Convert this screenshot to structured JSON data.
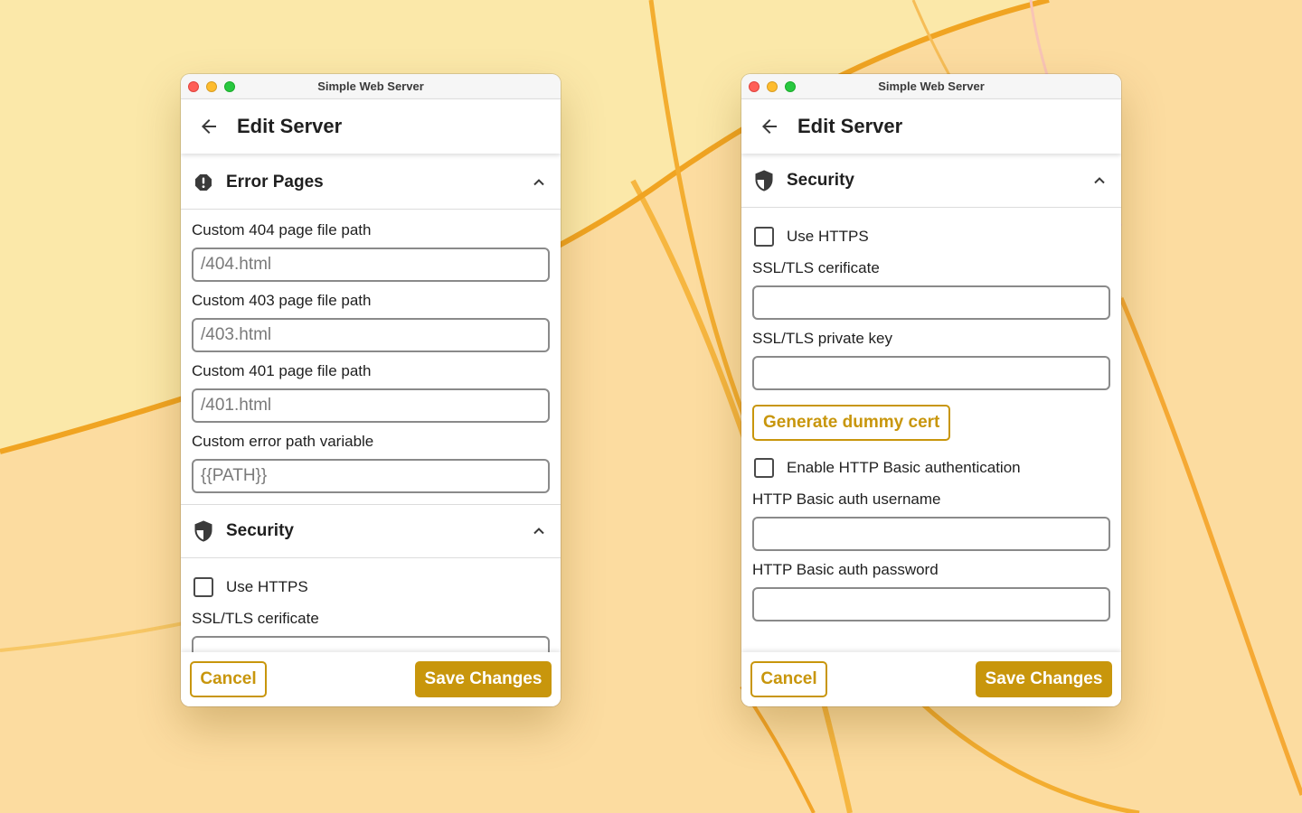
{
  "colors": {
    "accent": "#c8960c",
    "wallpaper_base": "#fbe7a6",
    "wallpaper_curve": "#f3a51d"
  },
  "left_window": {
    "title": "Simple Web Server",
    "appbar": {
      "title": "Edit Server",
      "back_icon": "arrow-left-icon"
    },
    "error_pages": {
      "title": "Error Pages",
      "icon": "error-octagon-icon",
      "chevron": "chevron-up-icon",
      "fields": [
        {
          "label": "Custom 404 page file path",
          "placeholder": "/404.html",
          "value": ""
        },
        {
          "label": "Custom 403 page file path",
          "placeholder": "/403.html",
          "value": ""
        },
        {
          "label": "Custom 401 page file path",
          "placeholder": "/401.html",
          "value": ""
        },
        {
          "label": "Custom error path variable",
          "placeholder": "{{PATH}}",
          "value": ""
        }
      ]
    },
    "security": {
      "title": "Security",
      "icon": "shield-icon",
      "chevron": "chevron-up-icon",
      "use_https_label": "Use HTTPS",
      "ssl_cert_label": "SSL/TLS cerificate"
    },
    "footer": {
      "cancel_label": "Cancel",
      "save_label": "Save Changes"
    }
  },
  "right_window": {
    "title": "Simple Web Server",
    "appbar": {
      "title": "Edit Server",
      "back_icon": "arrow-left-icon"
    },
    "security": {
      "title": "Security",
      "icon": "shield-icon",
      "chevron": "chevron-up-icon",
      "use_https_label": "Use HTTPS",
      "ssl_cert_label": "SSL/TLS cerificate",
      "ssl_cert_value": "",
      "ssl_key_label": "SSL/TLS private key",
      "ssl_key_value": "",
      "generate_cert_label": "Generate dummy cert",
      "basic_auth_label": "Enable HTTP Basic authentication",
      "basic_user_label": "HTTP Basic auth username",
      "basic_user_value": "",
      "basic_pass_label": "HTTP Basic auth password",
      "basic_pass_value": ""
    },
    "footer": {
      "cancel_label": "Cancel",
      "save_label": "Save Changes"
    }
  }
}
